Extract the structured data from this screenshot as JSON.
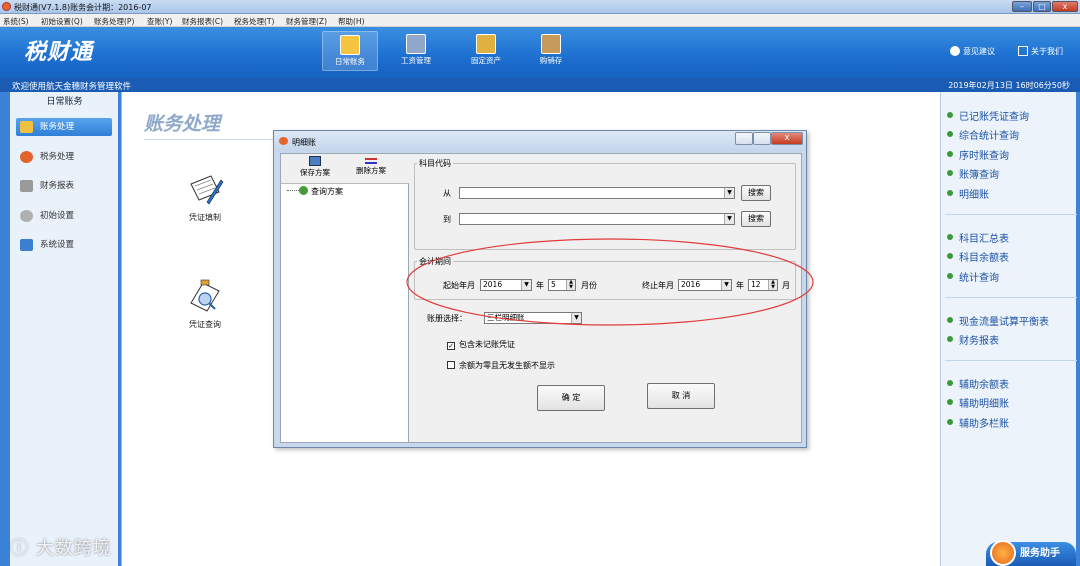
{
  "window": {
    "title": "税财通(V7.1.8)账务会计期：2016-07",
    "buttons": {
      "minimize": "–",
      "maximize": "□",
      "close": "x"
    }
  },
  "menu": [
    "系统(S)",
    "初始设置(Q)",
    "账务处理(P)",
    "查账(Y)",
    "财务报表(C)",
    "税务处理(T)",
    "财务管理(Z)",
    "帮助(H)"
  ],
  "header": {
    "logo": "税财通",
    "tools": [
      {
        "label": "日常账务",
        "icon": "ledger-icon",
        "color": "#f5c542"
      },
      {
        "label": "工资管理",
        "icon": "payroll-icon",
        "color": "#8fa7c8"
      },
      {
        "label": "固定资产",
        "icon": "assets-icon",
        "color": "#e0b040"
      },
      {
        "label": "购销存",
        "icon": "inventory-icon",
        "color": "#c59a5a"
      }
    ],
    "links": [
      {
        "label": "意见建议",
        "icon": "feedback-icon"
      },
      {
        "label": "关于我们",
        "icon": "home-icon"
      }
    ]
  },
  "status": {
    "welcome": "欢迎使用航天金穗财务管理软件",
    "datetime": "2019年02月13日  16时06分50秒"
  },
  "sidebar": {
    "section": "日常账务",
    "items": [
      {
        "label": "账务处理",
        "icon": "ledger-icon",
        "active": true
      },
      {
        "label": "税务处理",
        "icon": "tax-icon",
        "active": false
      },
      {
        "label": "财务报表",
        "icon": "report-icon",
        "active": false
      },
      {
        "label": "初始设置",
        "icon": "settings-icon",
        "active": false
      },
      {
        "label": "系统设置",
        "icon": "system-icon",
        "active": false
      }
    ]
  },
  "main": {
    "title": "账务处理",
    "tiles": [
      {
        "label": "凭证填制",
        "icon": "voucher-entry-icon"
      },
      {
        "label": "凭证查询",
        "icon": "voucher-query-icon"
      }
    ]
  },
  "right_panel": {
    "groups": [
      [
        "已记账凭证查询",
        "综合统计查询",
        "序时账查询",
        "账簿查询",
        "明细账"
      ],
      [
        "科目汇总表",
        "科目余额表",
        "统计查询"
      ],
      [
        "现金流量试算平衡表",
        "财务报表"
      ],
      [
        "辅助余额表",
        "辅助明细账",
        "辅助多栏账"
      ]
    ],
    "assistant": "服务助手"
  },
  "watermark": "大数跨境",
  "dialog": {
    "title": "明细账",
    "toolbar": {
      "save": "保存方案",
      "delete": "删除方案"
    },
    "tree_root": "查询方案",
    "subject_code": {
      "group": "科目代码",
      "from_label": "从",
      "to_label": "到",
      "search_label": "搜索",
      "from_value": "",
      "to_value": ""
    },
    "period": {
      "group": "会计期间",
      "start_label": "起始年月",
      "start_year": "2016",
      "year_unit": "年",
      "start_month": "5",
      "month_unit_start": "月份",
      "end_label": "终止年月",
      "end_year": "2016",
      "end_month": "12",
      "month_unit_end": "月"
    },
    "book": {
      "label": "账册选择：",
      "value": "三栏明细账"
    },
    "options": [
      {
        "label": "包含未记账凭证",
        "checked": true
      },
      {
        "label": "余额为零且无发生额不显示",
        "checked": false
      }
    ],
    "ok": "确 定",
    "cancel": "取 消"
  }
}
